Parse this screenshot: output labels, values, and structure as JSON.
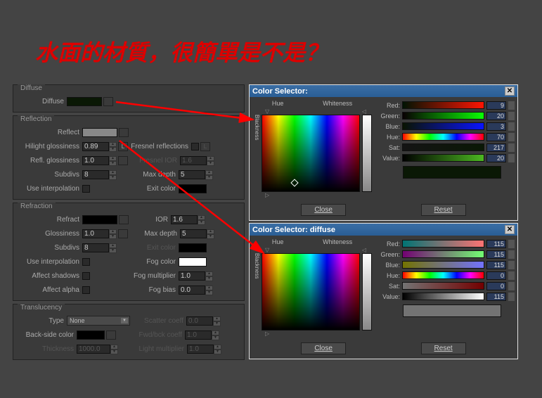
{
  "title": "水面的材質，很簡單是不是？",
  "groups": {
    "diffuse": {
      "title": "Diffuse",
      "diffuse_lbl": "Diffuse",
      "color": "#0a1805"
    },
    "reflection": {
      "title": "Reflection",
      "reflect_lbl": "Reflect",
      "reflect_color": "#888",
      "hilight_lbl": "Hilight glossiness",
      "hilight_val": "0.89",
      "l_lbl": "L",
      "fresnel_lbl": "Fresnel reflections",
      "fresnel_l": "L",
      "refl_gloss_lbl": "Refl. glossiness",
      "refl_gloss_val": "1.0",
      "fresnel_ior_lbl": "Fresnel IOR",
      "fresnel_ior_val": "1.6",
      "subdivs_lbl": "Subdivs",
      "subdivs_val": "8",
      "maxdepth_lbl": "Max depth",
      "maxdepth_val": "5",
      "interp_lbl": "Use interpolation",
      "exit_lbl": "Exit color",
      "exit_color": "#000"
    },
    "refraction": {
      "title": "Refraction",
      "refract_lbl": "Refract",
      "refract_color": "#000",
      "ior_lbl": "IOR",
      "ior_val": "1.6",
      "gloss_lbl": "Glossiness",
      "gloss_val": "1.0",
      "maxdepth_lbl": "Max depth",
      "maxdepth_val": "5",
      "subdivs_lbl": "Subdivs",
      "subdivs_val": "8",
      "exit_lbl": "Exit color",
      "exit_color": "#000",
      "interp_lbl": "Use interpolation",
      "fogcolor_lbl": "Fog color",
      "fog_color": "#fff",
      "shadows_lbl": "Affect shadows",
      "fogmult_lbl": "Fog multiplier",
      "fogmult_val": "1.0",
      "alpha_lbl": "Affect alpha",
      "fogbias_lbl": "Fog bias",
      "fogbias_val": "0.0"
    },
    "translucency": {
      "title": "Translucency",
      "type_lbl": "Type",
      "type_val": "None",
      "scatter_lbl": "Scatter coeff",
      "scatter_val": "0.0",
      "backside_lbl": "Back-side color",
      "backside_color": "#000",
      "fwdbck_lbl": "Fwd/bck coeff",
      "fwdbck_val": "1.0",
      "thickness_lbl": "Thickness",
      "thickness_val": "1000.0",
      "lightmult_lbl": "Light multiplier",
      "lightmult_val": "1.0"
    }
  },
  "cs1": {
    "title": "Color Selector:",
    "hue_lbl": "Hue",
    "white_lbl": "Whiteness",
    "black_lbl": "Blackness",
    "red_lbl": "Red:",
    "green_lbl": "Green:",
    "blue_lbl": "Blue:",
    "hue2_lbl": "Hue:",
    "sat_lbl": "Sat:",
    "value_lbl": "Value:",
    "red": "9",
    "green": "20",
    "blue": "3",
    "hue": "70",
    "sat": "217",
    "value": "20",
    "preview": "#0a1805",
    "close": "Close",
    "reset": "Reset"
  },
  "cs2": {
    "title": "Color Selector: diffuse",
    "hue_lbl": "Hue",
    "white_lbl": "Whiteness",
    "black_lbl": "Blackness",
    "red_lbl": "Red:",
    "green_lbl": "Green:",
    "blue_lbl": "Blue:",
    "hue2_lbl": "Hue:",
    "sat_lbl": "Sat:",
    "value_lbl": "Value:",
    "red": "115",
    "green": "115",
    "blue": "115",
    "hue": "0",
    "sat": "0",
    "value": "115",
    "preview": "#737373",
    "close": "Close",
    "reset": "Reset"
  }
}
